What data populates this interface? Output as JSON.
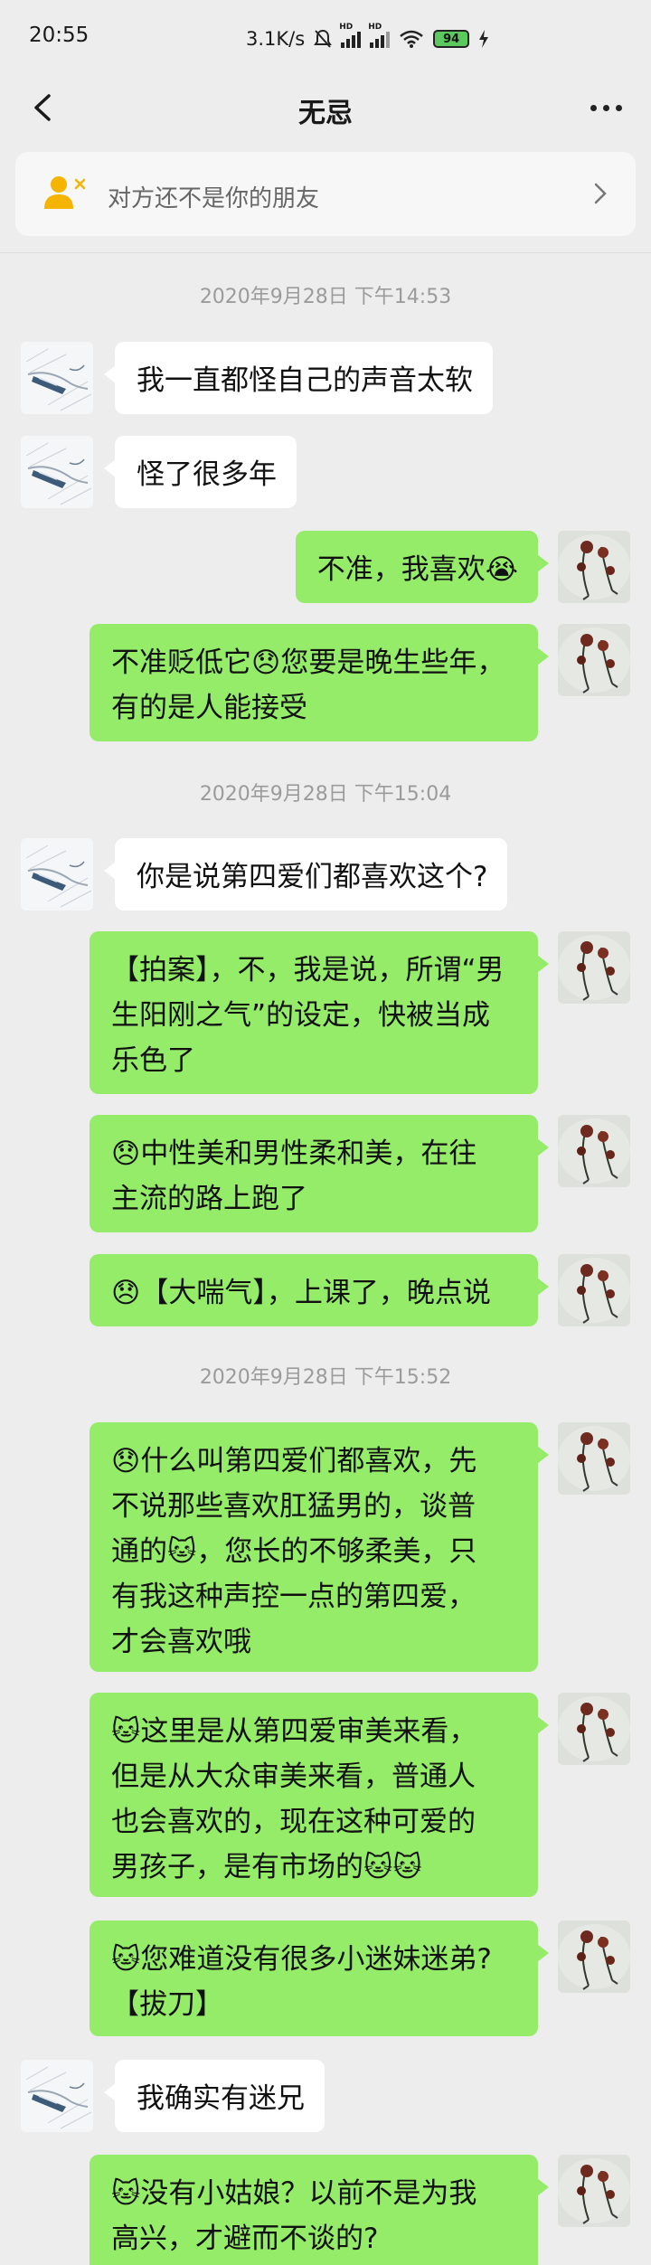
{
  "status_bar": {
    "time": "20:55",
    "network_speed": "3.1K/s",
    "signal_label_1": "HD",
    "signal_label_2": "HD",
    "battery": "94"
  },
  "header": {
    "title": "无忌",
    "back_icon": "chevron-left-icon",
    "more_icon": "more-dots-icon"
  },
  "banner": {
    "text": "对方还不是你的朋友",
    "icon": "add-friend-icon"
  },
  "colors": {
    "background": "#ededed",
    "sent_bubble": "#95ec69",
    "received_bubble": "#ffffff",
    "banner_icon": "#f4b400"
  },
  "messages": {
    "ts1": "2020年9月28日 下午14:53",
    "m1": "我一直都怪自己的声音太软",
    "m2": "怪了很多年",
    "m3": "不准，我喜欢😭",
    "m4": "不准贬低它😞您要是晚生些年，\n有的是人能接受",
    "ts2": "2020年9月28日 下午15:04",
    "m5": "你是说第四爱们都喜欢这个?",
    "m6": "【拍案】，不，我是说，所谓“男\n生阳刚之气”的设定，快被当成\n乐色了",
    "m7": "😞中性美和男性柔和美，在往\n主流的路上跑了",
    "m8": "😞【大喘气】，上课了，晚点说",
    "ts3": "2020年9月28日 下午15:52",
    "m9": "😞什么叫第四爱们都喜欢，先\n不说那些喜欢肛猛男的，谈普\n通的🐱，您长的不够柔美，只\n有我这种声控一点的第四爱，\n才会喜欢哦",
    "m10": "🐱这里是从第四爱审美来看，\n但是从大众审美来看，普通人\n也会喜欢的，现在这种可爱的\n男孩子，是有市场的🐱🐱",
    "m11": "🐱您难道没有很多小迷妹迷弟?\n【拔刀】",
    "m12": "我确实有迷兄",
    "m13": "🐱没有小姑娘？以前不是为我\n高兴，才避而不谈的?"
  }
}
